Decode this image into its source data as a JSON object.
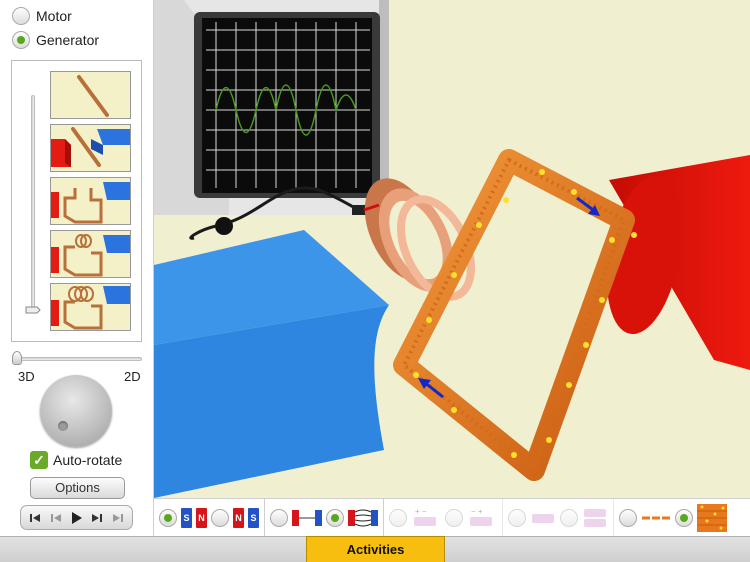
{
  "mode": {
    "options": [
      {
        "label": "Motor",
        "selected": false
      },
      {
        "label": "Generator",
        "selected": true
      }
    ]
  },
  "build_steps": {
    "items": [
      {
        "name": "wire"
      },
      {
        "name": "wire-between-magnets"
      },
      {
        "name": "loop-between-magnets"
      },
      {
        "name": "loop-with-small-coil"
      },
      {
        "name": "loop-with-coil"
      }
    ],
    "slider_position": "bottom"
  },
  "view": {
    "left_label": "3D",
    "right_label": "2D",
    "value_fraction": 0
  },
  "auto_rotate": {
    "label": "Auto-rotate",
    "checked": true,
    "check_glyph": "✓"
  },
  "options_button": {
    "label": "Options"
  },
  "playback": {
    "buttons": [
      "skip-to-start",
      "step-back",
      "play",
      "step-forward",
      "skip-to-end"
    ]
  },
  "toolbar": {
    "magnets": {
      "option_a": {
        "labels": [
          "S",
          "N"
        ],
        "selected": true
      },
      "option_b": {
        "labels": [
          "N",
          "S"
        ],
        "selected": false
      }
    },
    "field": {
      "option_a": {
        "name": "magnet-no-field-lines",
        "selected": false
      },
      "option_b": {
        "name": "magnet-with-field-lines",
        "selected": true
      }
    },
    "battery": {
      "option_a": {
        "labels": [
          "+",
          "−"
        ],
        "selected": false,
        "disabled": true
      },
      "option_b": {
        "labels": [
          "−",
          "+"
        ],
        "selected": false,
        "disabled": true
      }
    },
    "cells": {
      "option_a": {
        "name": "one-cell",
        "selected": false,
        "disabled": true
      },
      "option_b": {
        "name": "two-cells",
        "selected": false,
        "disabled": true
      }
    },
    "current_view": {
      "option_a": {
        "name": "current-arrow-view",
        "selected": false
      },
      "option_b": {
        "name": "electron-view",
        "selected": true
      }
    }
  },
  "bottom_tab": {
    "label": "Activities"
  },
  "colors": {
    "accent_green": "#5aa61e",
    "activities_yellow": "#f7be10",
    "magnet_red": "#e8140a",
    "magnet_blue": "#3d8fe6",
    "coil_orange": "#e8781e",
    "scene_background": "#f0efcf"
  }
}
